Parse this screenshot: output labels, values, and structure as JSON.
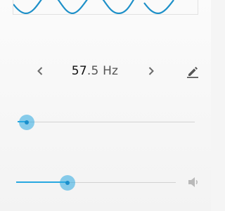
{
  "frequency": {
    "integer_part": "57",
    "decimal_part": ".5",
    "unit": "Hz"
  },
  "controls": {
    "prev_icon": "chevron-left-icon",
    "next_icon": "chevron-right-icon",
    "edit_icon": "pencil-icon",
    "volume_icon": "volume-icon"
  },
  "frequency_slider": {
    "level": 0.05
  },
  "volume_slider": {
    "level": 0.32
  },
  "colors": {
    "accent": "#29a8e0",
    "accent_dark": "#1a8fcc",
    "icon": "#6b6b6b"
  }
}
